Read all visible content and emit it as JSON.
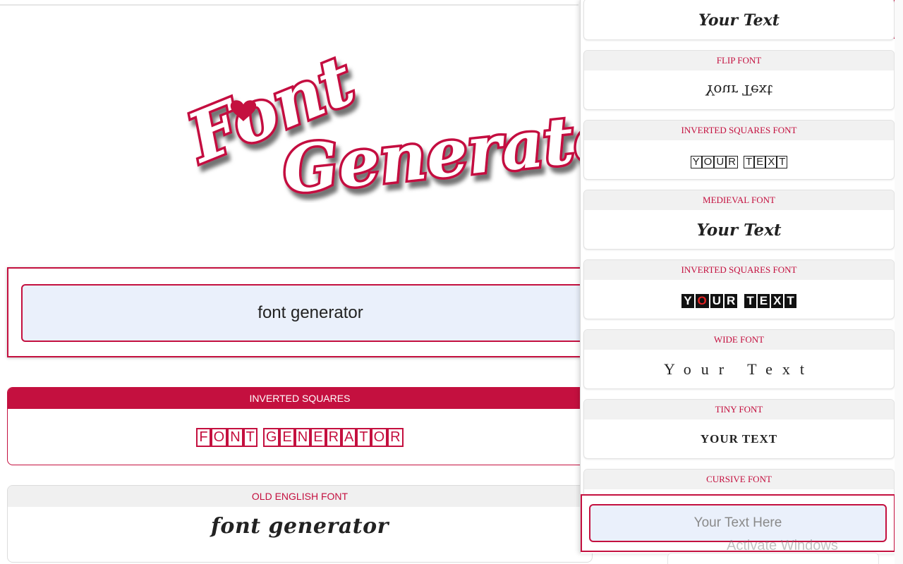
{
  "logo": {
    "line1": "Font",
    "line2": "Generator G"
  },
  "main_input": {
    "value": "font generator"
  },
  "results": [
    {
      "label": "INVERTED SQUARES",
      "words": [
        [
          "F",
          "O",
          "N",
          "T"
        ],
        [
          "G",
          "E",
          "N",
          "E",
          "R",
          "A",
          "T",
          "O",
          "R"
        ]
      ]
    },
    {
      "label": "OLD ENGLISH FONT",
      "text": "font generator"
    }
  ],
  "side_panel": {
    "top_preview": "Your Text",
    "cards": [
      {
        "label": "FLIP FONT",
        "preview": "Your Text"
      },
      {
        "label": "INVERTED SQUARES FONT",
        "words": [
          [
            "Y",
            "O",
            "U",
            "R"
          ],
          [
            "T",
            "E",
            "X",
            "T"
          ]
        ]
      },
      {
        "label": "MEDIEVAL FONT",
        "preview": "Your Text"
      },
      {
        "label": "INVERTED SQUARES FONT",
        "words": [
          [
            "Y",
            "O",
            "U",
            "R"
          ],
          [
            "T",
            "E",
            "X",
            "T"
          ]
        ]
      },
      {
        "label": "WIDE FONT",
        "preview": "Your Text"
      },
      {
        "label": "TINY FONT",
        "preview": "YOUR TEXT"
      },
      {
        "label": "CURSIVE FONT"
      }
    ],
    "input_placeholder": "Your Text Here"
  },
  "watermark": "Activate Windows",
  "colors": {
    "accent": "#c4103f",
    "input_bg": "#eaf0fb",
    "header_grey": "#f0f0f0"
  }
}
